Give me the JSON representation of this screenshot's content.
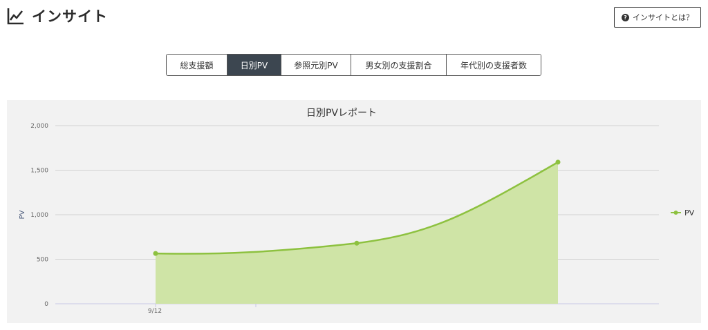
{
  "header": {
    "title": "インサイト",
    "icon": "trend-chart-icon",
    "help_label": "インサイトとは？"
  },
  "tabs": [
    {
      "label": "総支援額",
      "active": false
    },
    {
      "label": "日別PV",
      "active": true
    },
    {
      "label": "参照元別PV",
      "active": false
    },
    {
      "label": "男女別の支援割合",
      "active": false
    },
    {
      "label": "年代別の支援者数",
      "active": false
    }
  ],
  "colors": {
    "series": "#8dc13f",
    "fill": "#cfe4a6",
    "active_tab": "#3c4650"
  },
  "chart_data": {
    "type": "area",
    "title": "日別PVレポート",
    "ylabel": "PV",
    "xlabel": "",
    "ylim": [
      0,
      2000
    ],
    "yticks": [
      "0",
      "500",
      "1,000",
      "1,500",
      "2,000"
    ],
    "x_tick_labels": [
      "9/12"
    ],
    "legend_position": "right",
    "grid": true,
    "series": [
      {
        "name": "PV",
        "values": [
          565,
          680,
          1590
        ]
      }
    ]
  }
}
